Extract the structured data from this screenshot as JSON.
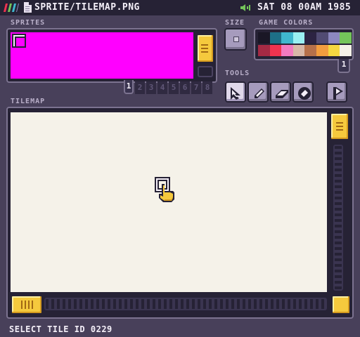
{
  "topbar": {
    "filename": "SPRITE/TILEMAP.PNG",
    "datetime": "SAT 08 00AM 1985",
    "logo_icon": "rainbow-stripes-logo",
    "file_icon": "document-icon",
    "speaker_icon": "speaker-icon"
  },
  "sprites": {
    "label": "SPRITES",
    "canvas_color": "#ff00ff",
    "pages": [
      "1",
      "2",
      "3",
      "4",
      "5",
      "6",
      "7",
      "8"
    ],
    "active_page": "1"
  },
  "size": {
    "label": "SIZE"
  },
  "game_colors": {
    "label": "GAME COLORS",
    "colors": [
      "#1a1726",
      "#1d6f86",
      "#3fb7cf",
      "#9af0f2",
      "#2c2342",
      "#514b73",
      "#8c88c0",
      "#74c55a",
      "#a52a44",
      "#f0334f",
      "#f27ac0",
      "#d8b8a8",
      "#b6704a",
      "#f29d3f",
      "#f4d741",
      "#f4f1e8"
    ],
    "page": "1"
  },
  "tools": {
    "label": "TOOLS",
    "items": [
      {
        "name": "select",
        "icon": "arrow-cursor-icon",
        "selected": true
      },
      {
        "name": "pencil",
        "icon": "pencil-icon",
        "selected": false
      },
      {
        "name": "eraser",
        "icon": "eraser-icon",
        "selected": false
      },
      {
        "name": "fill",
        "icon": "fill-icon",
        "selected": false
      },
      {
        "name": "play",
        "icon": "play-flag-icon",
        "selected": false
      }
    ]
  },
  "tilemap": {
    "label": "TILEMAP",
    "background": "#f5f2e9"
  },
  "status": {
    "text": "SELECT TILE ID 0229"
  },
  "accent": {
    "yellow": "#f5c93d",
    "panel_border": "#7c7390",
    "dark": "#262235"
  }
}
